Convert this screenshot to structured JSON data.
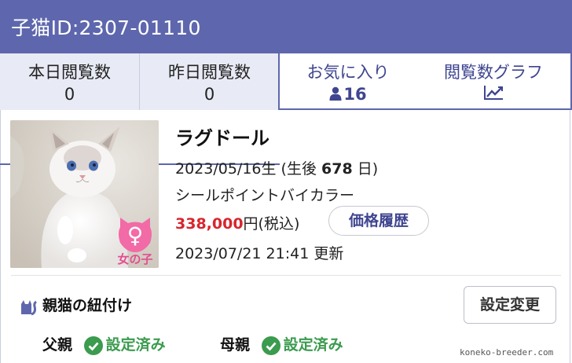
{
  "header": {
    "title": "子猫ID:2307-01110"
  },
  "tabs": [
    {
      "label": "本日閲覧数",
      "value": "0"
    },
    {
      "label": "昨日閲覧数",
      "value": "0"
    },
    {
      "label": "お気に入り",
      "value": "16",
      "icon": "user-icon"
    },
    {
      "label": "閲覧数グラフ",
      "icon": "chart-line-icon"
    }
  ],
  "kitten": {
    "breed": "ラグドール",
    "birth_prefix": "2023/05/16生 (生後 ",
    "age_days": "678",
    "birth_suffix": " 日)",
    "color": "シールポイントバイカラー",
    "price": "338,000",
    "price_suffix": "円(税込)",
    "price_history_button": "価格履歴",
    "updated": "2023/07/21 21:41 更新",
    "sex_badge": "女の子",
    "sex_symbol": "♀"
  },
  "parents": {
    "section_title": "親猫の紐付け",
    "settings_button": "設定変更",
    "father_label": "父親",
    "father_status": "設定済み",
    "mother_label": "母親",
    "mother_status": "設定済み"
  },
  "watermark": "koneko-breeder.com",
  "colors": {
    "header": "#5e67ad",
    "accent": "#3f4590",
    "price": "#d7262e",
    "ok": "#3b9b4e"
  }
}
